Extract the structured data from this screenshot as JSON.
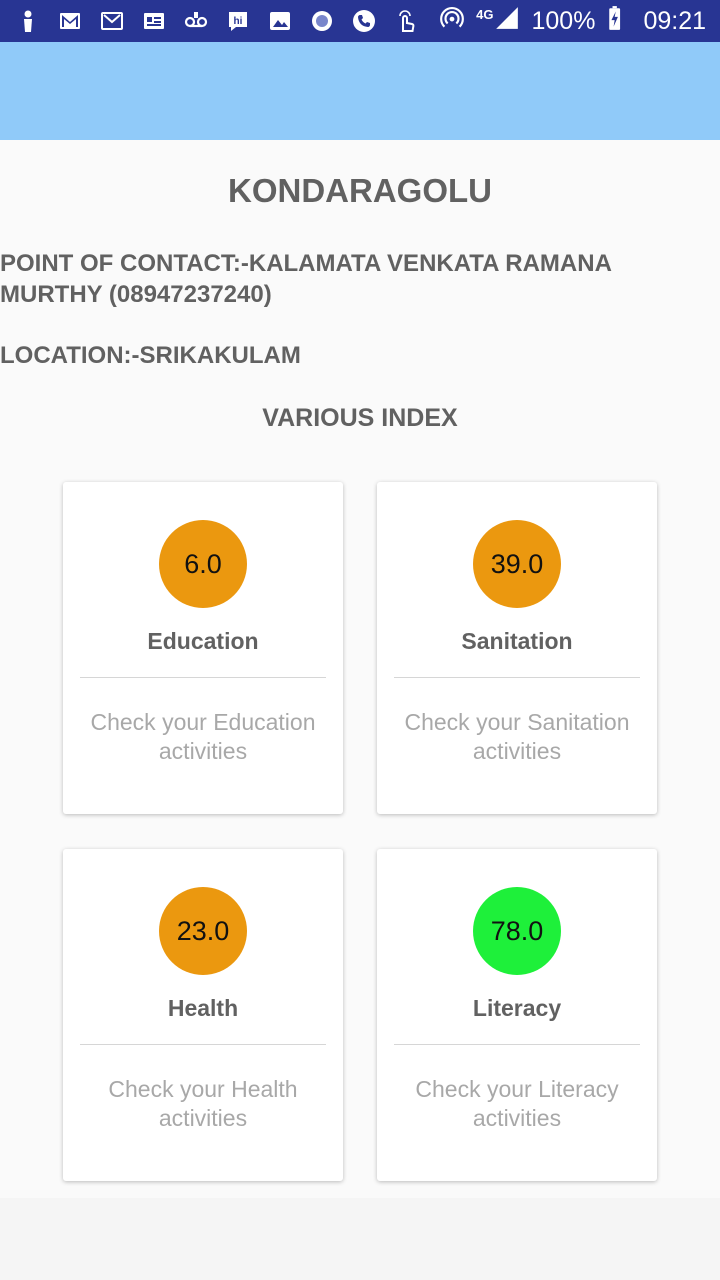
{
  "status_bar": {
    "battery": "100%",
    "time": "09:21",
    "network": "4G",
    "icons": [
      "person-icon",
      "gmail-icon",
      "gmail-icon",
      "id-card-icon",
      "voicemail-icon",
      "hike-icon",
      "image-icon",
      "record-icon",
      "phone-icon",
      "touch-icon",
      "hotspot-icon",
      "signal-icon",
      "battery-icon"
    ]
  },
  "header": {
    "village": "KONDARAGOLU",
    "contact": "POINT OF CONTACT:-KALAMATA VENKATA RAMANA MURTHY (08947237240)",
    "location": "LOCATION:-SRIKAKULAM",
    "section_title": "VARIOUS INDEX"
  },
  "cards": [
    {
      "value": "6.0",
      "label": "Education",
      "description": "Check your Education activities",
      "color": "#eb980f"
    },
    {
      "value": "39.0",
      "label": "Sanitation",
      "description": "Check your Sanitation activities",
      "color": "#eb980f"
    },
    {
      "value": "23.0",
      "label": "Health",
      "description": "Check your Health activities",
      "color": "#eb980f"
    },
    {
      "value": "78.0",
      "label": "Literacy",
      "description": "Check your Literacy activities",
      "color": "#1ef03a"
    }
  ],
  "colors": {
    "status_bar": "#283593",
    "app_bar": "#90caf9"
  }
}
